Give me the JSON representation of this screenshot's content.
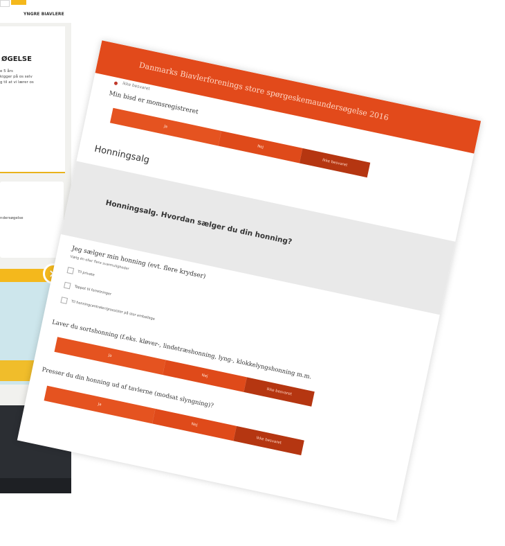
{
  "background_site": {
    "nav_link": "YNGRE BIAVLERE",
    "card1_title": "ØGELSE",
    "card1_lines": [
      "e 5 års",
      "kigger på os selv",
      "g til at vi lærer os"
    ],
    "card2_text": "ndersøgelse",
    "close_icon": "×"
  },
  "survey": {
    "header_title": "Danmarks Biavlerforenings store spørgeskemaundersøgelse 2016",
    "previous_option_text": "ikke besvaret",
    "q_moms": {
      "text": "Min bisd er momsregistreret",
      "options": [
        "Ja",
        "Nej",
        "Ikke besvaret"
      ]
    },
    "section_title": "Honningsalg",
    "section_box_text": "Honningsalg. Hvordan sælger du din honning?",
    "q_salg": {
      "text": "Jeg sælger min honning (evt. flere krydser)",
      "hint": "Vælg én eller flere svarmuligheder",
      "options": [
        "Til private",
        "Tappet til forretninger",
        "Til honningcentraler/grossister på stor emballage"
      ]
    },
    "q_sortshonning": {
      "text": "Laver du sortshonning (f.eks. kløver-, lindetræshonning, lyng-, klokkelyngshonning m.m.",
      "options": [
        "Ja",
        "Nej",
        "Ikke besvaret"
      ]
    },
    "q_presser": {
      "text": "Presser du din honning ud af tavlerne (modsat slyngning)?",
      "options": [
        "Ja",
        "Nej",
        "Ikke besvaret"
      ]
    }
  },
  "colors": {
    "header": "#e24a1b",
    "button": "#e55320",
    "button_unanswered": "#b53611",
    "section_box": "#e9e9e9",
    "accent_yellow": "#f4b81c"
  }
}
